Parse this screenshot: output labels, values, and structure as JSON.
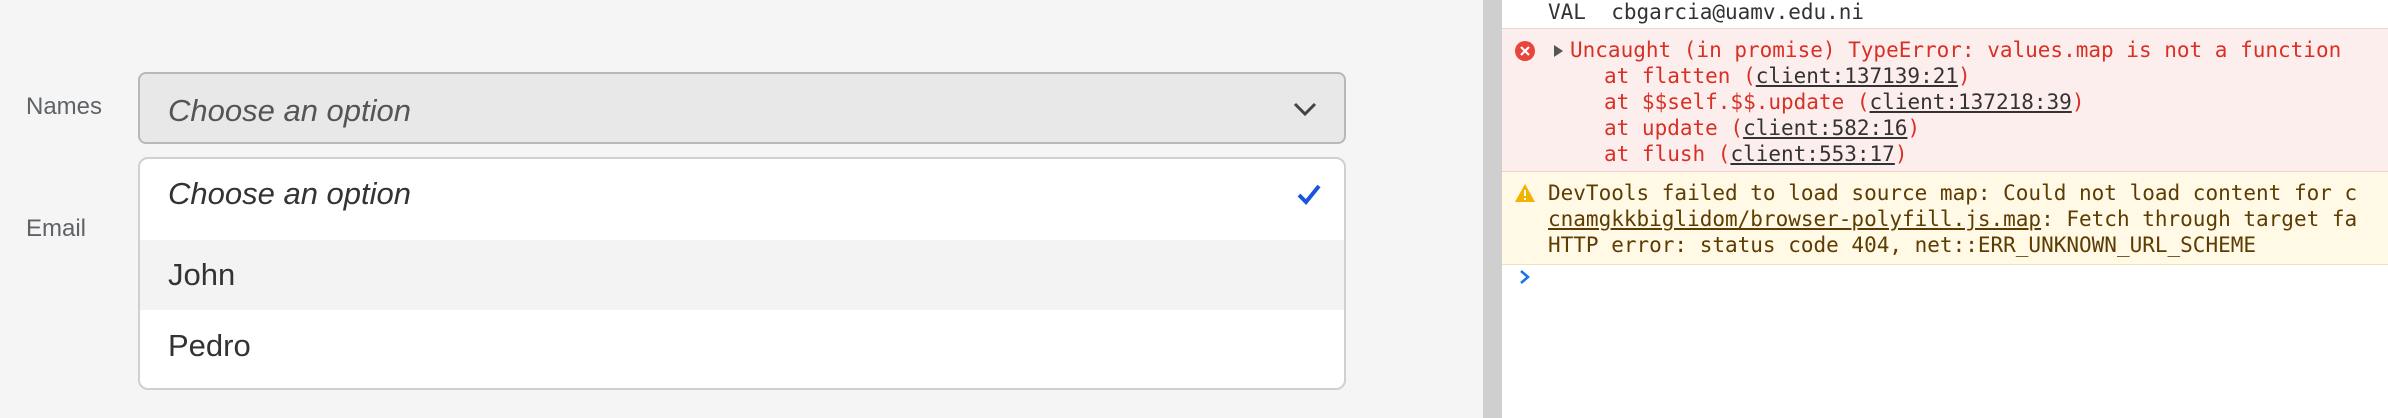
{
  "form": {
    "names_label": "Names",
    "email_label": "Email",
    "select_value": "Choose an option",
    "options": [
      {
        "label": "Choose an option",
        "selected": true
      },
      {
        "label": "John",
        "selected": false
      },
      {
        "label": "Pedro",
        "selected": false
      }
    ]
  },
  "console": {
    "val_line": "VAL  cbgarcia@uamv.edu.ni",
    "error": {
      "message": "Uncaught (in promise) TypeError: values.map is not a function",
      "stack": [
        {
          "prefix": "at flatten (",
          "link": "client:137139:21",
          "suffix": ")"
        },
        {
          "prefix": "at $$self.$$.update (",
          "link": "client:137218:39",
          "suffix": ")"
        },
        {
          "prefix": "at update (",
          "link": "client:582:16",
          "suffix": ")"
        },
        {
          "prefix": "at flush (",
          "link": "client:553:17",
          "suffix": ")"
        }
      ]
    },
    "warning": {
      "line1": "DevTools failed to load source map: Could not load content for c",
      "link": "cnamgkkbiglidom/browser-polyfill.js.map",
      "line2_rest": ": Fetch through target fa",
      "line3": "HTTP error: status code 404, net::ERR_UNKNOWN_URL_SCHEME"
    }
  },
  "colors": {
    "error_text": "#d93025",
    "warning_text": "#5c3c00",
    "check_blue": "#1a56db",
    "prompt_blue": "#1a73e8"
  }
}
